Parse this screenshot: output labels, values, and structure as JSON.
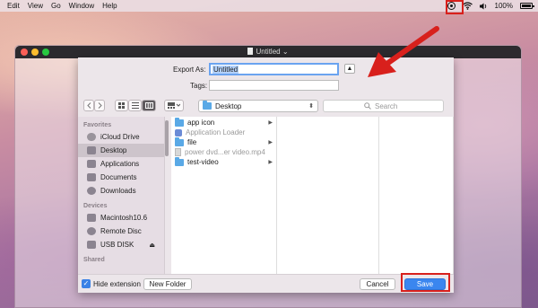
{
  "menubar": {
    "items": [
      "Edit",
      "View",
      "Go",
      "Window",
      "Help"
    ],
    "battery_text": "100%"
  },
  "window": {
    "title": "Untitled",
    "chevron": "⌄"
  },
  "dialog": {
    "export_as_label": "Export As:",
    "export_as_value": "Untitled",
    "tags_label": "Tags:",
    "tags_value": "",
    "expand_glyph": "▲",
    "location": "Desktop",
    "search_placeholder": "Search"
  },
  "sidebar": {
    "favorites_header": "Favorites",
    "favorites": [
      {
        "label": "iCloud Drive",
        "icon": "cloud-icon"
      },
      {
        "label": "Desktop",
        "icon": "desktop-icon",
        "selected": true
      },
      {
        "label": "Applications",
        "icon": "applications-icon"
      },
      {
        "label": "Documents",
        "icon": "documents-icon"
      },
      {
        "label": "Downloads",
        "icon": "downloads-icon"
      }
    ],
    "devices_header": "Devices",
    "devices": [
      {
        "label": "Macintosh10.6",
        "icon": "hard-drive-icon"
      },
      {
        "label": "Remote Disc",
        "icon": "disc-icon"
      },
      {
        "label": "USB DISK",
        "icon": "usb-drive-icon",
        "eject": "⏏"
      }
    ],
    "shared_header": "Shared"
  },
  "files": [
    {
      "name": "app icon",
      "type": "folder",
      "dim": false
    },
    {
      "name": "Application Loader",
      "type": "app",
      "dim": true
    },
    {
      "name": "file",
      "type": "folder",
      "dim": false
    },
    {
      "name": "power dvd...er video.mp4",
      "type": "file",
      "dim": true
    },
    {
      "name": "test-video",
      "type": "folder",
      "dim": false
    }
  ],
  "footer": {
    "hide_extension_label": "Hide extension",
    "hide_extension_checked": true,
    "new_folder_label": "New Folder",
    "cancel_label": "Cancel",
    "save_label": "Save"
  },
  "colors": {
    "annotation": "#d8201c",
    "accent": "#3a86ef"
  }
}
